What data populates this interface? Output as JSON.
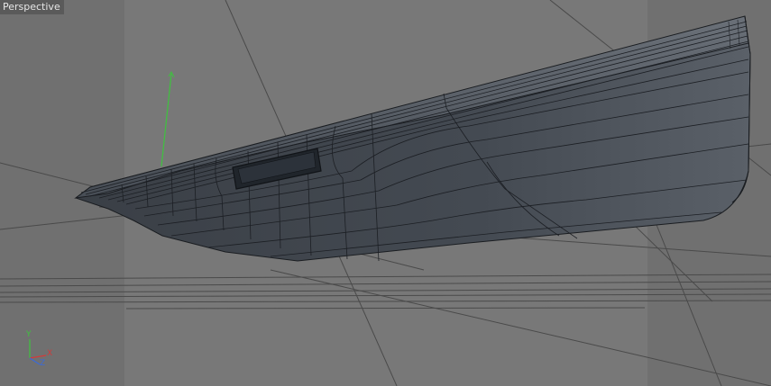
{
  "viewport": {
    "name": "Perspective"
  },
  "axes": {
    "y_label": "Y",
    "x_label": "X",
    "z_label": "Z",
    "y_color": "#3ec23e",
    "x_color": "#d23a3a",
    "z_color": "#3a6ad8"
  },
  "colors": {
    "background": "#707070",
    "safe_frame": "#787878",
    "model_surface": "#3f444b",
    "wire": "#111418",
    "grid": "#454545"
  }
}
